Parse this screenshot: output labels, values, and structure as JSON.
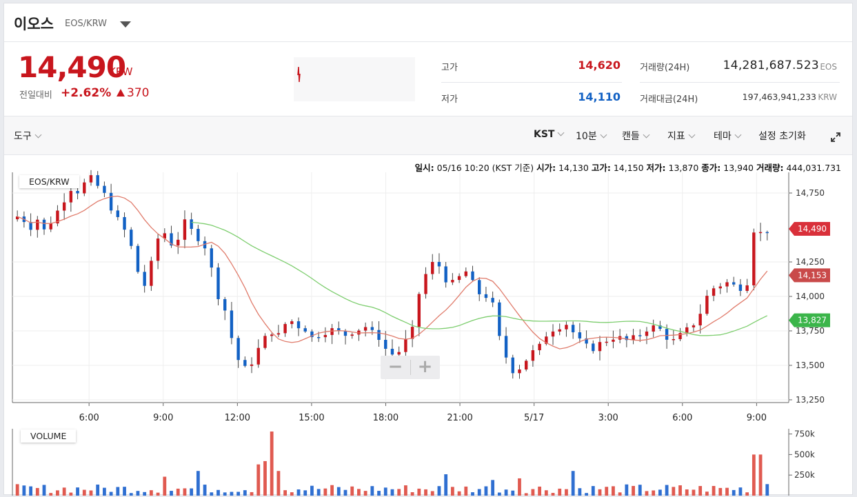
{
  "header": {
    "coin_name": "이오스",
    "pair": "EOS/KRW"
  },
  "ticker": {
    "price": "14,490",
    "price_unit": "KRW",
    "change_label": "전일대비",
    "change_pct": "+2.62%",
    "change_amt": "370",
    "high_label": "고가",
    "high": "14,620",
    "low_label": "저가",
    "low": "14,110",
    "volume_label": "거래량(24H)",
    "volume": "14,281,687.523",
    "volume_unit": "EOS",
    "value_label": "거래대금(24H)",
    "value": "197,463,941,233",
    "value_unit": "KRW"
  },
  "colors": {
    "up": "#c8161d",
    "down": "#1261c4",
    "ma_short": "#e07b6b",
    "ma_long": "#7ccd6d",
    "vol_up": "#e05a50",
    "vol_down": "#2f6fd1"
  },
  "toolbar": {
    "tools": "도구",
    "timezone": "KST",
    "interval": "10분",
    "chart_type": "캔들",
    "indicator": "지표",
    "theme": "테마",
    "reset": "설정 초기화"
  },
  "info": {
    "date_label": "일시:",
    "date": "05/16 10:20 (KST 기준)",
    "open_label": "시가:",
    "open": "14,130",
    "high_label": "고가:",
    "high": "14,150",
    "low_label": "저가:",
    "low": "13,870",
    "close_label": "종가:",
    "close": "13,940",
    "vol_label": "거래량:",
    "vol": "444,031.731"
  },
  "series_label": "EOS/KRW",
  "volume_label": "VOLUME",
  "zoom": {
    "minus": "−",
    "plus": "+"
  },
  "chart_data": {
    "type": "candlestick",
    "price_ticks": [
      "14,750",
      "14,250",
      "14,000",
      "13,750",
      "13,500",
      "13,250"
    ],
    "price_tick_values": [
      14750,
      14250,
      14000,
      13750,
      13500,
      13250
    ],
    "ylim": [
      13230,
      14900
    ],
    "time_ticks": [
      "6:00",
      "9:00",
      "12:00",
      "15:00",
      "18:00",
      "21:00",
      "5/17",
      "3:00",
      "6:00",
      "9:00"
    ],
    "time_tick_hours": [
      6,
      9,
      12,
      15,
      18,
      21,
      24,
      27,
      30,
      33
    ],
    "xlim_hours": [
      2.9,
      34.3
    ],
    "price_tags": [
      {
        "label": "14,490",
        "value": 14490,
        "color": "#d9303a"
      },
      {
        "label": "14,153",
        "value": 14153,
        "color": "#c94a4a"
      },
      {
        "label": "13,827",
        "value": 13827,
        "color": "#3bb54a"
      }
    ],
    "volume_ticks": [
      "750k",
      "500k",
      "250k"
    ],
    "volume_tick_values": [
      750000,
      500000,
      250000
    ],
    "volume_max": 780000,
    "close_path": [
      14580,
      14550,
      14500,
      14560,
      14480,
      14540,
      14620,
      14700,
      14780,
      14760,
      14820,
      14860,
      14800,
      14740,
      14640,
      14560,
      14480,
      14360,
      14180,
      14080,
      14240,
      14420,
      14460,
      14380,
      14420,
      14540,
      14480,
      14420,
      14360,
      14200,
      14000,
      13900,
      13700,
      13540,
      13480,
      13520,
      13620,
      13700,
      13740,
      13720,
      13800,
      13820,
      13780,
      13760,
      13700,
      13720,
      13740,
      13760,
      13740,
      13720,
      13740,
      13760,
      13780,
      13740,
      13700,
      13620,
      13580,
      13600,
      13680,
      13760,
      14020,
      14160,
      14240,
      14220,
      14120,
      14100,
      14140,
      14180,
      14100,
      14020,
      14000,
      13940,
      13700,
      13560,
      13460,
      13480,
      13540,
      13600,
      13640,
      13720,
      13760,
      13780,
      13800,
      13740,
      13680,
      13640,
      13620,
      13660,
      13680,
      13700,
      13700,
      13680,
      13700,
      13720,
      13760,
      13780,
      13760,
      13700,
      13680,
      13720,
      13760,
      13800,
      13880,
      14000,
      14060,
      14080,
      14100,
      14080,
      14060,
      14100,
      14480,
      14460,
      14480
    ]
  }
}
